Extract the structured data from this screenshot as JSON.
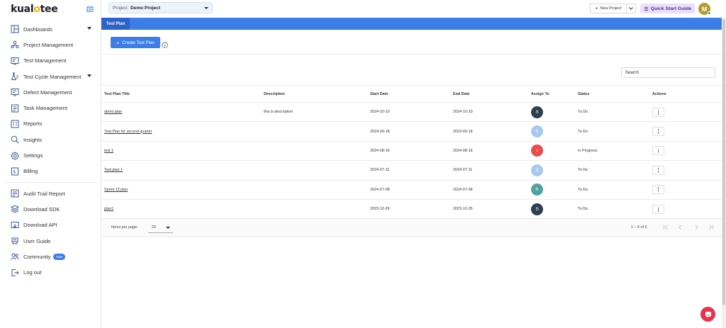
{
  "brand": {
    "name_prefix": "kual",
    "name_o": "o",
    "name_suffix": "tee"
  },
  "sidebar": {
    "items": [
      {
        "label": "Dashboards",
        "icon": "dashboard-icon",
        "expandable": true
      },
      {
        "label": "Project Management",
        "icon": "project-management-icon"
      },
      {
        "label": "Test Management",
        "icon": "test-management-icon"
      },
      {
        "label": "Test Cycle Management",
        "icon": "test-cycle-icon",
        "expandable": true
      },
      {
        "label": "Defect Management",
        "icon": "defect-icon"
      },
      {
        "label": "Task Management",
        "icon": "task-icon"
      },
      {
        "label": "Reports",
        "icon": "reports-icon"
      },
      {
        "label": "Insights",
        "icon": "insights-icon"
      },
      {
        "label": "Settings",
        "icon": "settings-icon"
      },
      {
        "label": "Billing",
        "icon": "billing-icon"
      }
    ],
    "secondary": [
      {
        "label": "Audit Trail Report",
        "icon": "audit-icon"
      },
      {
        "label": "Download SDK",
        "icon": "download-sdk-icon"
      },
      {
        "label": "Download API",
        "icon": "download-api-icon"
      },
      {
        "label": "User Guide",
        "icon": "user-guide-icon"
      },
      {
        "label": "Community",
        "icon": "community-icon",
        "badge": "New"
      },
      {
        "label": "Log out",
        "icon": "logout-icon"
      }
    ]
  },
  "topbar": {
    "project_label": "Project:",
    "project_value": "Demo Project",
    "new_project": "New Project",
    "quick_start": "Quick Start Guide",
    "user_initial": "M"
  },
  "tabs": {
    "active": "Test Plan"
  },
  "toolbar": {
    "create_label": "Create Test Plan"
  },
  "search": {
    "placeholder": "Search"
  },
  "table": {
    "headers": {
      "title": "Test Plan Title",
      "description": "Description",
      "start_date": "Start Date",
      "end_date": "End Date",
      "assign_to": "Assign To",
      "status": "Status",
      "actions": "Actions"
    },
    "rows": [
      {
        "title": "demo plan",
        "description": "this is description",
        "start": "2024-10-10",
        "end": "2024-10-10",
        "initial": "S",
        "avatar_color": "#2f3e4e",
        "status": "To Do"
      },
      {
        "title": "Test Plan for second quarter",
        "description": "",
        "start": "2024-09-18",
        "end": "2024-09-18",
        "initial": "S",
        "avatar_color": "#a8c8f0",
        "status": "To Do"
      },
      {
        "title": "test 1",
        "description": "",
        "start": "2024-08-16",
        "end": "2024-08-16",
        "initial": "I",
        "avatar_color": "#ea4b4b",
        "status": "In Progress"
      },
      {
        "title": "Test plan 1",
        "description": "",
        "start": "2024-07-11",
        "end": "2024-07-11",
        "initial": "S",
        "avatar_color": "#a8c8f0",
        "status": "To Do"
      },
      {
        "title": "Sprint 13 plan",
        "description": "",
        "start": "2024-07-08",
        "end": "2024-07-08",
        "initial": "K",
        "avatar_color": "#4fa3a0",
        "status": "To Do"
      },
      {
        "title": "plan1",
        "description": "",
        "start": "2023-12-26",
        "end": "2023-12-26",
        "initial": "S",
        "avatar_color": "#2f3e4e",
        "status": "To Do"
      }
    ]
  },
  "paginator": {
    "items_per_page_label": "Items per page:",
    "page_size": "20",
    "range": "1 – 6 of 6"
  },
  "colors": {
    "primary": "#3c7de6",
    "chat": "#e8334a",
    "quick_start_bg": "#ecdffc"
  }
}
